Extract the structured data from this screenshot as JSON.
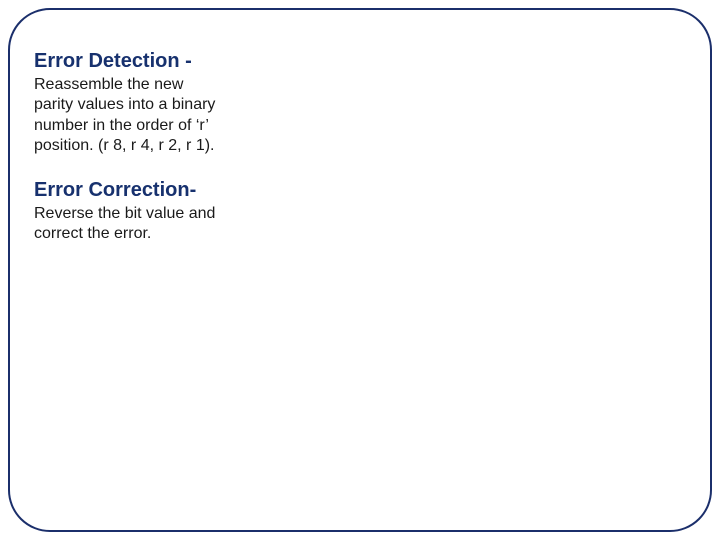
{
  "slide": {
    "section1": {
      "title": "Error Detection -",
      "body": "Reassemble the new parity values into a binary number in the order of ‘r’ position. (r 8, r 4, r 2, r 1)."
    },
    "section2": {
      "title": "Error Correction-",
      "body": "Reverse the bit value and correct the error."
    }
  }
}
